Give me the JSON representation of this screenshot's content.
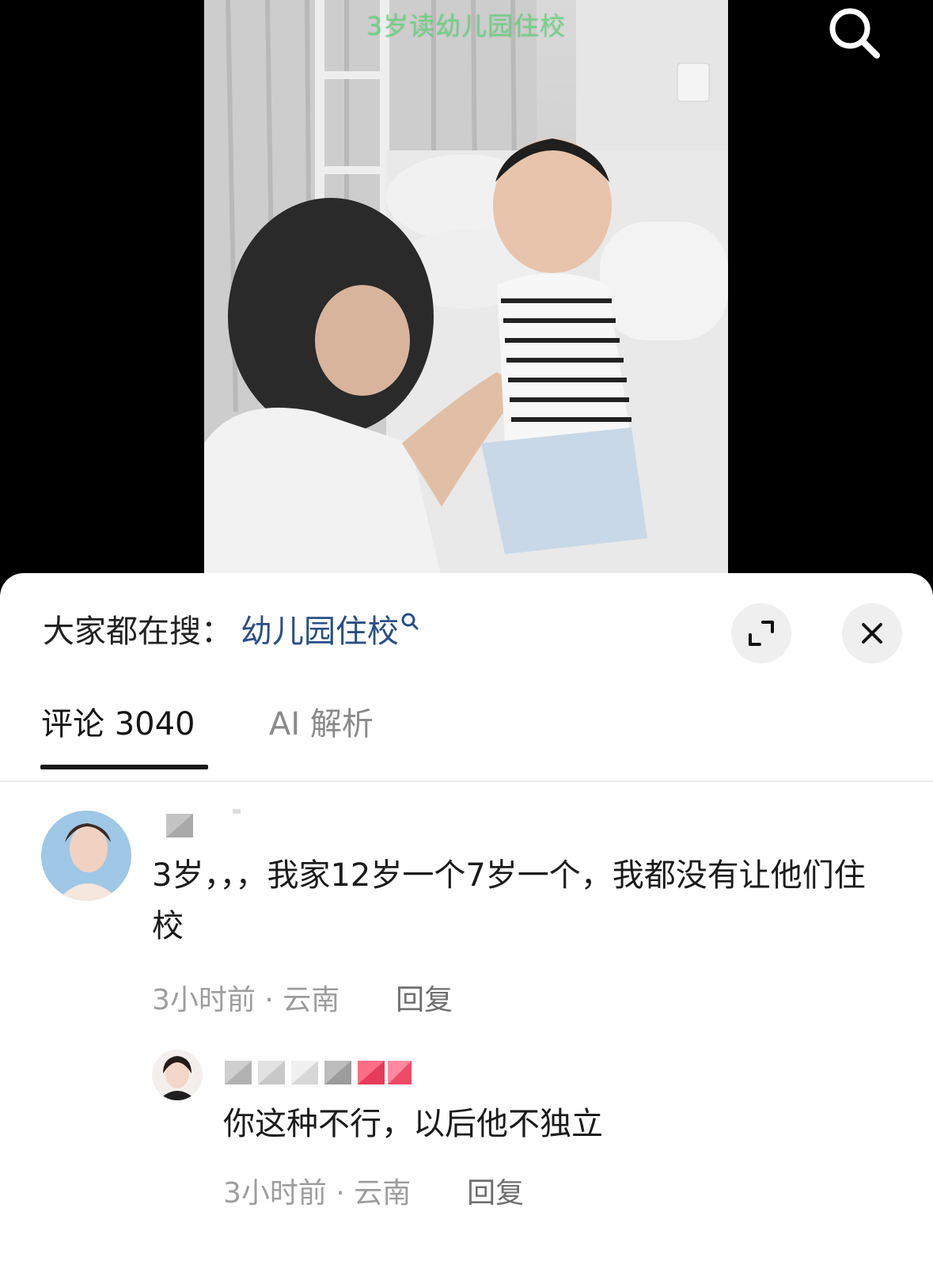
{
  "video": {
    "caption": "3岁读幼儿园住校"
  },
  "icons": {
    "search": "search-icon",
    "expand": "expand-icon",
    "close": "close-icon",
    "hot_search": "search-small-icon"
  },
  "hot_search": {
    "prefix": "大家都在搜：",
    "keyword": "幼儿园住校"
  },
  "tabs": [
    {
      "label": "评论 3040",
      "active": true
    },
    {
      "label": "AI 解析",
      "active": false
    }
  ],
  "comments": [
    {
      "text": "3岁，，，我家12岁一个7岁一个，我都没有让他们住校",
      "time": "3小时前",
      "location": "云南",
      "reply_label": "回复"
    },
    {
      "text": "你这种不行，以后他不独立",
      "time": "3小时前",
      "location": "云南",
      "reply_label": "回复"
    }
  ],
  "colors": {
    "link": "#2a4e86",
    "caption": "#4fd36a",
    "meta": "#9d9d9d"
  }
}
